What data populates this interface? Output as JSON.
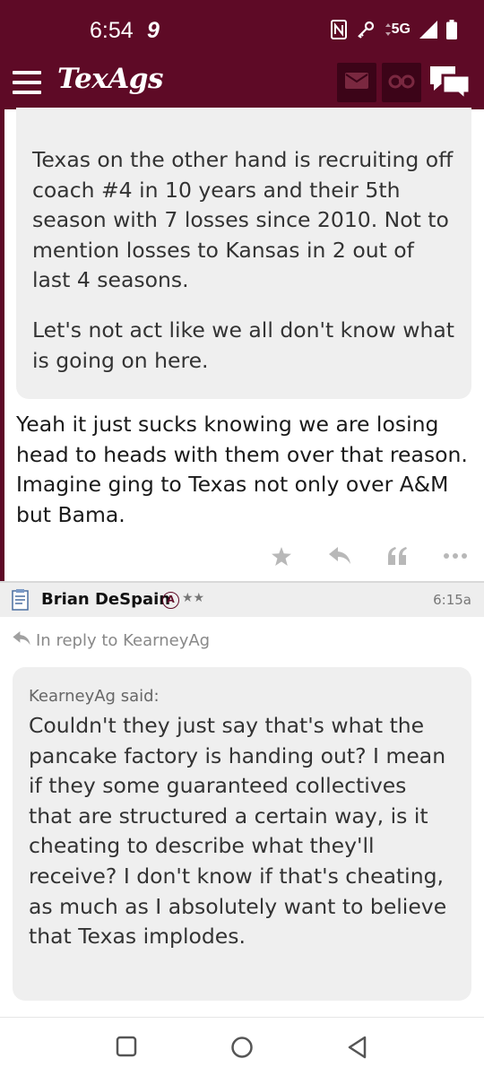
{
  "status_bar": {
    "time": "6:54",
    "notification": "9",
    "network": "5G",
    "icons": [
      "nfc-icon",
      "key-icon",
      "signal-icon",
      "battery-icon"
    ]
  },
  "app_bar": {
    "logo": "TexAgs",
    "icons": [
      "menu-icon",
      "mail-icon",
      "binoculars-icon",
      "chat-icon"
    ]
  },
  "previous_post": {
    "quote_paragraphs": [
      "Texas on the other hand is recruiting off coach #4 in 10 years and their 5th season with 7 losses since 2010. Not to mention losses to Kansas in 2 out of last 4 seasons.",
      "Let's not act like we all don't know what is going on here."
    ],
    "body": "Yeah it just sucks knowing we are losing head to heads with them over that reason. Imagine ging to Texas not only over A&M but Bama.",
    "actions": [
      "star-icon",
      "reply-icon",
      "quote-icon",
      "more-icon"
    ]
  },
  "post": {
    "author": "Brian DeSpain",
    "badge": "A",
    "stars": "★★",
    "time": "6:15a",
    "reply_to": "In reply to KearneyAg",
    "quote_attribution": "KearneyAg said:",
    "quote_text": "Couldn't they just say that's what the pancake factory is handing out? I mean if they some guaranteed collectives that are structured a certain way, is it cheating to describe what they'll receive? I don't know if that's cheating, as much as I absolutely want to believe that Texas implodes."
  },
  "nav_bar": {
    "buttons": [
      "recent-apps-button",
      "home-button",
      "back-button"
    ]
  },
  "colors": {
    "brand": "#5e0a26",
    "brand_dark": "#3c0418",
    "quote_bg": "#efefef",
    "muted": "#b8b8b8"
  }
}
